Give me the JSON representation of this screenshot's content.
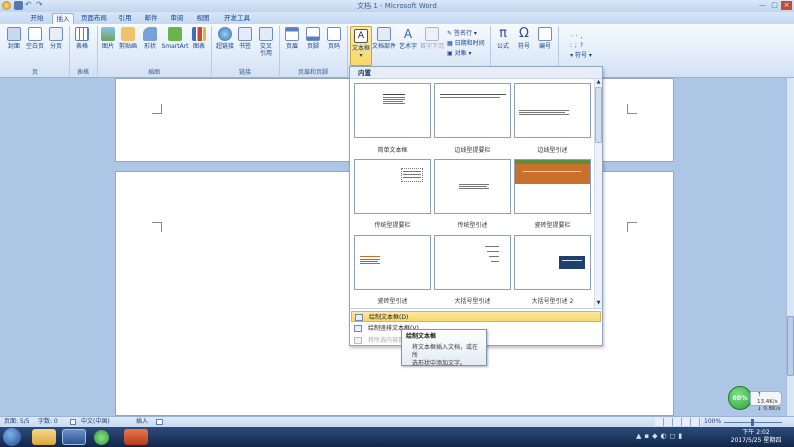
{
  "window": {
    "title": "文档 1 - Microsoft Word"
  },
  "tabs": [
    {
      "label": "开始"
    },
    {
      "label": "插入"
    },
    {
      "label": "页面布局"
    },
    {
      "label": "引用"
    },
    {
      "label": "邮件"
    },
    {
      "label": "审阅"
    },
    {
      "label": "视图"
    },
    {
      "label": "开发工具"
    }
  ],
  "ribbon": {
    "buttons": {
      "cover": "封面",
      "blank_page": "空白页",
      "page_break": "分页",
      "table": "表格",
      "picture": "图片",
      "clipart": "剪贴画",
      "shapes": "形状",
      "smartart": "SmartArt",
      "chart": "图表",
      "hyperlink": "超链接",
      "bookmark": "书签",
      "crossref_1": "交叉",
      "crossref_2": "引用",
      "header": "页眉",
      "footer": "页脚",
      "page_number": "页码",
      "textbox": "文本框",
      "quickparts": "文档部件",
      "wordart": "艺术字",
      "dropcap": "首字下沉",
      "signature_line": "签名行",
      "date_time": "日期和时间",
      "object": "对象",
      "equation": "公式",
      "symbol": "符号",
      "number": "编号",
      "special_symbol": "符号"
    },
    "groups": {
      "pages": "页",
      "tables": "表格",
      "illustrations": "插图",
      "links": "链接",
      "header_footer": "页眉和页脚"
    }
  },
  "gallery": {
    "header": "内置",
    "items": [
      {
        "label": "简单文本框"
      },
      {
        "label": "边线型提要栏"
      },
      {
        "label": "边线型引述"
      },
      {
        "label": "传统型提要栏"
      },
      {
        "label": "传统型引述"
      },
      {
        "label": "瓷砖型提要栏"
      },
      {
        "label": "瓷砖型引述"
      },
      {
        "label": "大括号型引述"
      },
      {
        "label": "大括号型引述 2"
      }
    ],
    "menu": [
      {
        "label": "绘制文本框(D)"
      },
      {
        "label": "绘制竖排文本框(V)"
      },
      {
        "label": "将所选内容保存到文本框库(S)"
      }
    ]
  },
  "tooltip": {
    "title": "绘制文本框",
    "line1": "将文本框插入文档，或在所",
    "line2": "选形状中添加文字。"
  },
  "statusbar": {
    "page": "页面: 5/5",
    "words": "字数: 0",
    "lang": "中文(中国)",
    "mode": "插入",
    "zoom": "100%"
  },
  "network": {
    "percent": "60%",
    "up": "13.4K/s",
    "down": "0.8K/s"
  },
  "clock": {
    "time": "下午 2:02",
    "date": "2017/5/25 星期四"
  },
  "colors": {
    "accent": "#f8d868",
    "ribbon": "#e3edf9",
    "doc_bg": "#aec6e6",
    "net_green": "#3cb84a"
  }
}
